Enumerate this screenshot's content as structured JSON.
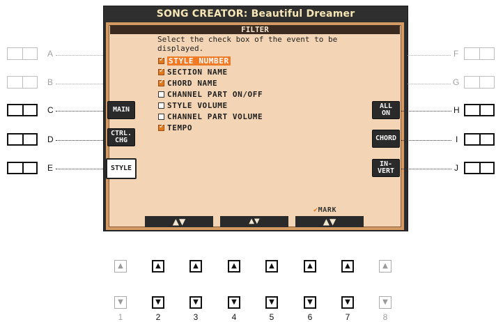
{
  "title": "SONG CREATOR: Beautiful Dreamer",
  "filter_header": "FILTER",
  "instructions": {
    "line1": "Select the check box of the event to be",
    "line2": "displayed."
  },
  "events": [
    {
      "label": "STYLE NUMBER",
      "checked": true,
      "highlighted": true
    },
    {
      "label": "SECTION NAME",
      "checked": true
    },
    {
      "label": "CHORD NAME",
      "checked": true
    },
    {
      "label": "CHANNEL PART ON/OFF",
      "checked": false
    },
    {
      "label": "STYLE VOLUME",
      "checked": false
    },
    {
      "label": "CHANNEL PART VOLUME",
      "checked": false
    },
    {
      "label": "TEMPO",
      "checked": true
    }
  ],
  "left_tabs": {
    "main": "MAIN",
    "ctrl_line1": "CTRL.",
    "ctrl_line2": "CHG",
    "style": "STYLE"
  },
  "right_tabs": {
    "all_line1": "ALL",
    "all_line2": "ON",
    "chord": "CHORD",
    "invert_line1": "IN-",
    "invert_line2": "VERT"
  },
  "mark_label": "MARK",
  "bottom_arrows": {
    "b1": "▲▼",
    "b2": "▲▼",
    "b3": "▲▼"
  },
  "side_letters": {
    "A": "A",
    "B": "B",
    "C": "C",
    "D": "D",
    "E": "E",
    "F": "F",
    "G": "G",
    "H": "H",
    "I": "I",
    "J": "J"
  },
  "numbers": [
    "1",
    "2",
    "3",
    "4",
    "5",
    "6",
    "7",
    "8"
  ],
  "colors": {
    "panel_bg": "#f3d4b4",
    "accent_orange": "#f07a26",
    "title_text": "#f6e6b6"
  }
}
